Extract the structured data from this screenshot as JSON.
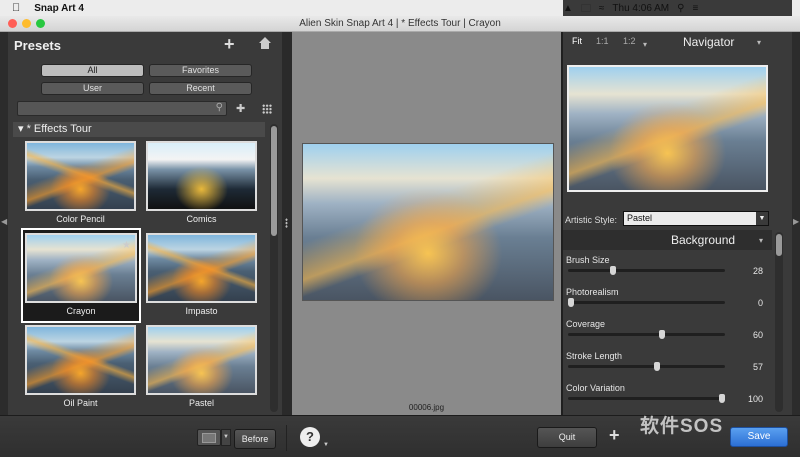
{
  "menubar": {
    "app_name": "Snap Art 4",
    "clock": "Thu 4:06 AM"
  },
  "window": {
    "title": "Alien Skin Snap Art 4 | * Effects Tour | Crayon"
  },
  "presets": {
    "title": "Presets",
    "filters": [
      "All",
      "Favorites",
      "User",
      "Recent"
    ],
    "active_filter": "All",
    "search_placeholder": "",
    "group": "* Effects Tour",
    "items": [
      {
        "label": "Color Pencil"
      },
      {
        "label": "Comics"
      },
      {
        "label": "Crayon",
        "selected": true,
        "favorite": true
      },
      {
        "label": "Impasto"
      },
      {
        "label": "Oil Paint"
      },
      {
        "label": "Pastel"
      }
    ]
  },
  "canvas": {
    "filename": "00006.jpg"
  },
  "navigator": {
    "zoom_options": [
      "Fit",
      "1:1",
      "1:2"
    ],
    "active_zoom": "Fit",
    "title": "Navigator"
  },
  "settings": {
    "artistic_style_label": "Artistic Style:",
    "artistic_style_value": "Pastel",
    "section_title": "Background",
    "sliders": [
      {
        "label": "Brush Size",
        "value": "28",
        "fraction": 0.28
      },
      {
        "label": "Photorealism",
        "value": "0",
        "fraction": 0.0
      },
      {
        "label": "Coverage",
        "value": "60",
        "fraction": 0.6
      },
      {
        "label": "Stroke Length",
        "value": "57",
        "fraction": 0.57
      },
      {
        "label": "Color Variation",
        "value": "100",
        "fraction": 1.0
      }
    ]
  },
  "bottombar": {
    "before_label": "Before",
    "help_label": "?",
    "quit_label": "Quit",
    "save_label": "Save"
  },
  "watermark": "软件SOS",
  "colors": {
    "accent": "#2c6fd4",
    "panel": "#3a3a3a",
    "canvas": "#8a8a8a"
  }
}
